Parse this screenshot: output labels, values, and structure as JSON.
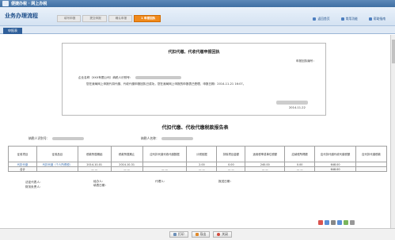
{
  "window": {
    "title": "便捷办税 · 网上办税"
  },
  "process": {
    "title": "业务办理流程",
    "steps": [
      "填写申报",
      "提交申报",
      "确认申报",
      "1 申报回执"
    ],
    "links": [
      "返回首页",
      "常用功能",
      "帮助指南"
    ]
  },
  "tab": {
    "label": "申报表"
  },
  "receipt": {
    "title": "代扣代缴、代收代缴申报回执",
    "number_label": "申报回执编号：",
    "line1": "企业名称（XXX有限公司）纳税人识别号：",
    "line2": "您在我局网上申报代扣代缴、代收代缴申报回执已成功，您在我局网上申报的申报表已受理，申报日期：2014-11-21 16:07。",
    "date": "2014-11-22"
  },
  "report": {
    "title": "代扣代缴、代收代缴税款报告表",
    "taxpayer_label": "纳税人识别号：",
    "name_label": "纳税人名称："
  },
  "table": {
    "headers": [
      "征收项目",
      "征收品目",
      "税款所属期起",
      "税款所属期止",
      "应代扣代缴代收代缴数据",
      "计税依据",
      "扣除项目金额",
      "适用税率或单位税额",
      "应纳税所得额",
      "应代扣代缴代收代缴税额",
      "应代扣代缴税款"
    ],
    "rows": [
      [
        "代扣代缴",
        "代扣代缴（个人所得税）",
        "2014-10-01",
        "2014-10-31",
        "",
        "2.00",
        "0.00",
        "240.00",
        "0.00",
        "648.00",
        ""
      ],
      [
        "合计",
        "",
        "— —",
        "— —",
        "— —",
        "— —",
        "— —",
        "— —",
        "— —",
        "648.00",
        ""
      ]
    ]
  },
  "signatures": {
    "legal": "法定代表人：",
    "manager": "财务负责人：",
    "handler": "经办人：",
    "prepare_date": "填表日期：",
    "agent": "代理人：",
    "report_date": "报送日期："
  },
  "bottom": {
    "buttons": [
      "打印",
      "导出",
      "关闭"
    ]
  },
  "colors": {
    "accent": "#f08a1c",
    "brand": "#2f5f9a"
  }
}
